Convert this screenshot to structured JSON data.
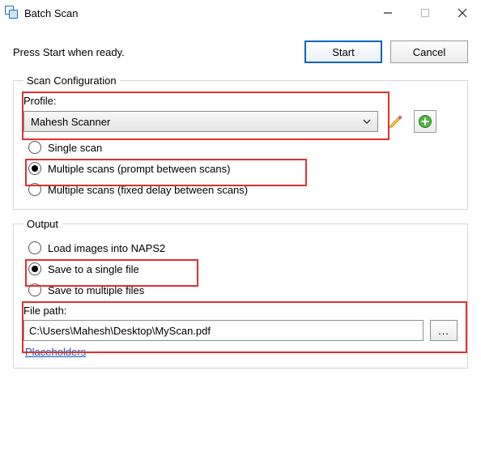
{
  "window": {
    "title": "Batch Scan"
  },
  "top": {
    "prompt": "Press Start when ready.",
    "start": "Start",
    "cancel": "Cancel"
  },
  "scan_config": {
    "legend": "Scan Configuration",
    "profile_label": "Profile:",
    "profile_value": "Mahesh Scanner",
    "radios": {
      "single": "Single scan",
      "multi_prompt": "Multiple scans (prompt between scans)",
      "multi_delay": "Multiple scans (fixed delay between scans)"
    },
    "selected": "multi_prompt"
  },
  "output": {
    "legend": "Output",
    "radios": {
      "load": "Load images into NAPS2",
      "single_file": "Save to a single file",
      "multi_file": "Save to multiple files"
    },
    "selected": "single_file",
    "filepath_label": "File path:",
    "filepath_value": "C:\\Users\\Mahesh\\Desktop\\MyScan.pdf",
    "browse": "...",
    "placeholders": "Placeholders"
  },
  "icons": {
    "edit": "pencil-icon",
    "add": "plus-icon"
  }
}
